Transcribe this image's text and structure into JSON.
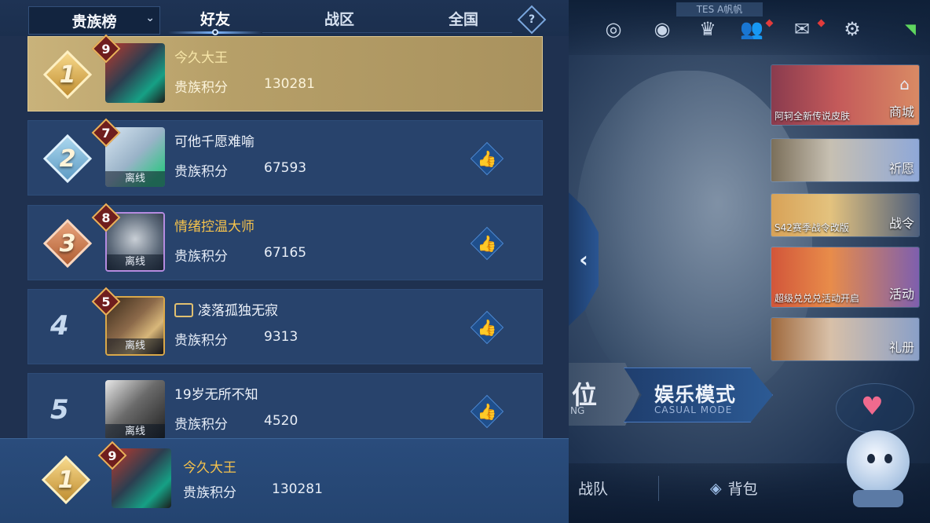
{
  "header": {
    "dropdown_label": "贵族榜",
    "tabs": [
      "好友",
      "战区",
      "全国"
    ],
    "active_tab": "好友",
    "help_label": "?"
  },
  "rows": [
    {
      "rank": "1",
      "level": "9",
      "name": "今久大王",
      "score_label": "贵族积分",
      "score": "130281",
      "offline": "",
      "badge": "gold"
    },
    {
      "rank": "2",
      "level": "7",
      "name": "可他千愿难喻",
      "score_label": "贵族积分",
      "score": "67593",
      "offline": "离线",
      "badge": "silver"
    },
    {
      "rank": "3",
      "level": "8",
      "name": "情绪控温大师",
      "score_label": "贵族积分",
      "score": "67165",
      "offline": "离线",
      "badge": "bronze"
    },
    {
      "rank": "4",
      "level": "5",
      "name": "凌落孤独无寂",
      "score_label": "贵族积分",
      "score": "9313",
      "offline": "离线",
      "badge": "plain"
    },
    {
      "rank": "5",
      "level": "",
      "name": "19岁无所不知",
      "score_label": "贵族积分",
      "score": "4520",
      "offline": "离线",
      "badge": "plain"
    }
  ],
  "self": {
    "rank": "1",
    "level": "9",
    "name": "今久大王",
    "score_label": "贵族积分",
    "score": "130281"
  },
  "lobby": {
    "tes_label": "TES A帆帆",
    "banners": [
      {
        "caption": "阿轲全新传说皮肤",
        "tag": "商城"
      },
      {
        "caption": "",
        "tag": "祈愿"
      },
      {
        "caption": "S42赛季战令改版",
        "tag": "战令"
      },
      {
        "caption": "超级兑兑兑活动开启",
        "tag": "活动"
      },
      {
        "caption": "",
        "tag": "礼册"
      }
    ],
    "mode_rank": "位",
    "mode_rank_en": "NG",
    "mode_casual": "娱乐模式",
    "mode_casual_en": "CASUAL MODE",
    "bottom_team": "战队",
    "bottom_bag": "背包"
  },
  "icons": {
    "like": "thumbs-up-icon",
    "collapse": "chevron-left-icon"
  }
}
